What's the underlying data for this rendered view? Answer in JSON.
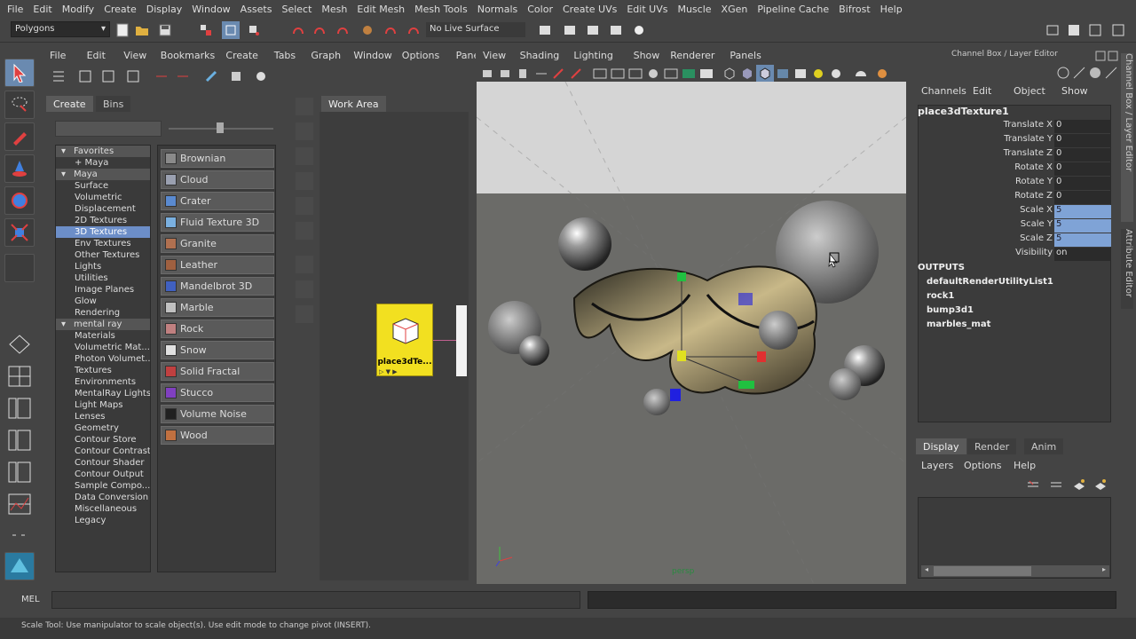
{
  "menubar": [
    "File",
    "Edit",
    "Modify",
    "Create",
    "Display",
    "Window",
    "Assets",
    "Select",
    "Mesh",
    "Edit Mesh",
    "Mesh Tools",
    "Normals",
    "Color",
    "Create UVs",
    "Edit UVs",
    "Muscle",
    "XGen",
    "Pipeline Cache",
    "Bifrost",
    "Help"
  ],
  "statusline": {
    "menu_set": "Polygons",
    "live_surface": "No Live Surface"
  },
  "hypershade": {
    "menu": [
      "File",
      "Edit",
      "View",
      "Bookmarks",
      "Create",
      "Tabs",
      "Graph",
      "Window",
      "Options",
      "Panels"
    ],
    "tabs": [
      "Create",
      "Bins"
    ],
    "work_tab": "Work Area",
    "tree": [
      {
        "label": "Favorites",
        "type": "head"
      },
      {
        "label": "+ Maya",
        "type": "child"
      },
      {
        "label": "Maya",
        "type": "head"
      },
      {
        "label": "Surface",
        "type": "child"
      },
      {
        "label": "Volumetric",
        "type": "child"
      },
      {
        "label": "Displacement",
        "type": "child"
      },
      {
        "label": "2D Textures",
        "type": "child"
      },
      {
        "label": "3D Textures",
        "type": "selected"
      },
      {
        "label": "Env Textures",
        "type": "child"
      },
      {
        "label": "Other Textures",
        "type": "child"
      },
      {
        "label": "Lights",
        "type": "child"
      },
      {
        "label": "Utilities",
        "type": "child"
      },
      {
        "label": "Image Planes",
        "type": "child"
      },
      {
        "label": "Glow",
        "type": "child"
      },
      {
        "label": "Rendering",
        "type": "child"
      },
      {
        "label": "mental ray",
        "type": "head"
      },
      {
        "label": "Materials",
        "type": "child"
      },
      {
        "label": "Volumetric Mat...",
        "type": "child"
      },
      {
        "label": "Photon Volumet...",
        "type": "child"
      },
      {
        "label": "Textures",
        "type": "child"
      },
      {
        "label": "Environments",
        "type": "child"
      },
      {
        "label": "MentalRay Lights",
        "type": "child"
      },
      {
        "label": "Light Maps",
        "type": "child"
      },
      {
        "label": "Lenses",
        "type": "child"
      },
      {
        "label": "Geometry",
        "type": "child"
      },
      {
        "label": "Contour Store",
        "type": "child"
      },
      {
        "label": "Contour Contrast",
        "type": "child"
      },
      {
        "label": "Contour Shader",
        "type": "child"
      },
      {
        "label": "Contour Output",
        "type": "child"
      },
      {
        "label": "Sample Compo...",
        "type": "child"
      },
      {
        "label": "Data Conversion",
        "type": "child"
      },
      {
        "label": "Miscellaneous",
        "type": "child"
      },
      {
        "label": "Legacy",
        "type": "child"
      }
    ],
    "textures": [
      {
        "label": "Brownian",
        "color": "#8a8a8a"
      },
      {
        "label": "Cloud",
        "color": "#9aa0b0"
      },
      {
        "label": "Crater",
        "color": "#5a8ad0"
      },
      {
        "label": "Fluid Texture 3D",
        "color": "#7ab0e0"
      },
      {
        "label": "Granite",
        "color": "#b07050"
      },
      {
        "label": "Leather",
        "color": "#a06040"
      },
      {
        "label": "Mandelbrot 3D",
        "color": "#4060c0"
      },
      {
        "label": "Marble",
        "color": "#c0c0c0"
      },
      {
        "label": "Rock",
        "color": "#c08080"
      },
      {
        "label": "Snow",
        "color": "#e0e0e0"
      },
      {
        "label": "Solid Fractal",
        "color": "#c04040"
      },
      {
        "label": "Stucco",
        "color": "#8040c0"
      },
      {
        "label": "Volume Noise",
        "color": "#202020"
      },
      {
        "label": "Wood",
        "color": "#c07040"
      }
    ],
    "node": {
      "label": "place3dTe..."
    }
  },
  "viewport": {
    "menu": [
      "View",
      "Shading",
      "Lighting",
      "Show",
      "Renderer",
      "Panels"
    ],
    "camera": "persp"
  },
  "channel_box": {
    "title": "Channel Box / Layer Editor",
    "menu": [
      "Channels",
      "Edit",
      "Object",
      "Show"
    ],
    "object": "place3dTexture1",
    "attrs": [
      {
        "label": "Translate X",
        "value": "0",
        "hl": false
      },
      {
        "label": "Translate Y",
        "value": "0",
        "hl": false
      },
      {
        "label": "Translate Z",
        "value": "0",
        "hl": false
      },
      {
        "label": "Rotate X",
        "value": "0",
        "hl": false
      },
      {
        "label": "Rotate Y",
        "value": "0",
        "hl": false
      },
      {
        "label": "Rotate Z",
        "value": "0",
        "hl": false
      },
      {
        "label": "Scale X",
        "value": "5",
        "hl": true
      },
      {
        "label": "Scale Y",
        "value": "5",
        "hl": true
      },
      {
        "label": "Scale Z",
        "value": "5",
        "hl": true
      },
      {
        "label": "Visibility",
        "value": "on",
        "hl": false
      }
    ],
    "outputs_label": "OUTPUTS",
    "outputs": [
      "defaultRenderUtilityList1",
      "rock1",
      "bump3d1",
      "marbles_mat"
    ]
  },
  "side_tabs": [
    "Channel Box / Layer Editor",
    "Attribute Editor"
  ],
  "layer_editor": {
    "tabs": [
      "Display",
      "Render",
      "Anim"
    ],
    "menu": [
      "Layers",
      "Options",
      "Help"
    ]
  },
  "mel_label": "MEL",
  "help_line": "Scale Tool: Use manipulator to scale object(s). Use edit mode to change pivot (INSERT)."
}
